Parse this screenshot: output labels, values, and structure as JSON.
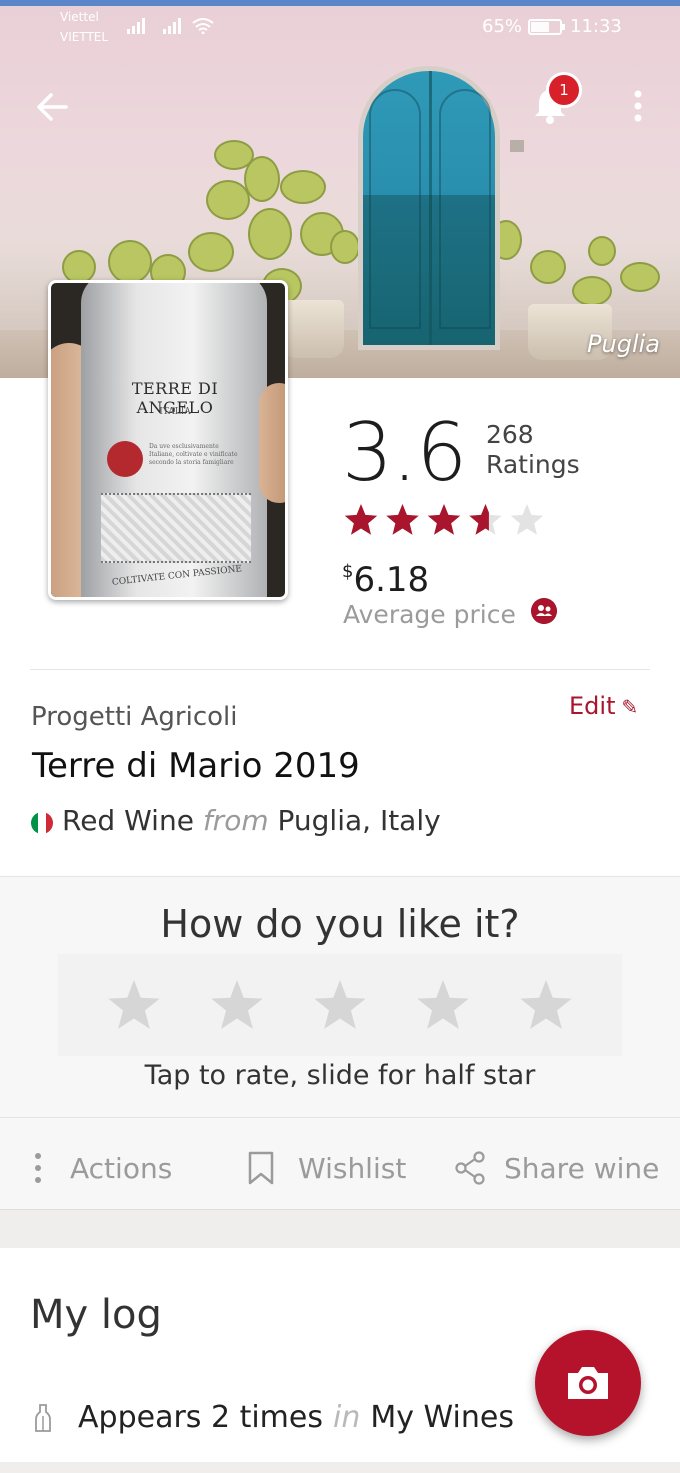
{
  "status_bar": {
    "carrier_primary": "Viettel",
    "carrier_secondary": "VIETTEL",
    "battery_percent": "65%",
    "battery_level": 0.65,
    "time": "11:33"
  },
  "hero": {
    "region_tag": "Puglia",
    "notification_count": "1",
    "icons": {
      "back": "arrow-left-icon",
      "notifications": "bell-icon",
      "more": "more-vertical-icon"
    }
  },
  "bottle_label": {
    "brand": "TERRE DI ANGELO",
    "country": "ITALIA",
    "small_text": "Da uve esclusivamente Italiane, coltivate e vinificate secondo la storia famigliare",
    "motto": "COLTIVATE CON PASSIONE"
  },
  "rating": {
    "score": "3.6",
    "count": "268",
    "count_label": "Ratings",
    "stars_value": 3.6,
    "stars_max": 5,
    "star_color": "#a8152c"
  },
  "price": {
    "currency": "$",
    "amount": "6.18",
    "label": "Average price"
  },
  "wine": {
    "winery": "Progetti Agricoli",
    "name": "Terre di Mario 2019",
    "type": "Red Wine",
    "from_word": "from",
    "origin": "Puglia, Italy",
    "edit_label": "Edit",
    "flag_colors": [
      "#009246",
      "#ffffff",
      "#ce2b37"
    ]
  },
  "rate_prompt": {
    "question": "How do you like it?",
    "hint": "Tap to rate, slide for half star",
    "star_count": 5
  },
  "actions": [
    {
      "label": "Actions",
      "icon": "more-vertical-icon"
    },
    {
      "label": "Wishlist",
      "icon": "bookmark-icon"
    },
    {
      "label": "Share wine",
      "icon": "share-icon"
    }
  ],
  "my_log": {
    "title": "My log",
    "appears_prefix": "Appears 2 times",
    "in_word": "in",
    "collection": "My Wines"
  },
  "colors": {
    "accent": "#a8152c",
    "fab": "#b5122c"
  }
}
